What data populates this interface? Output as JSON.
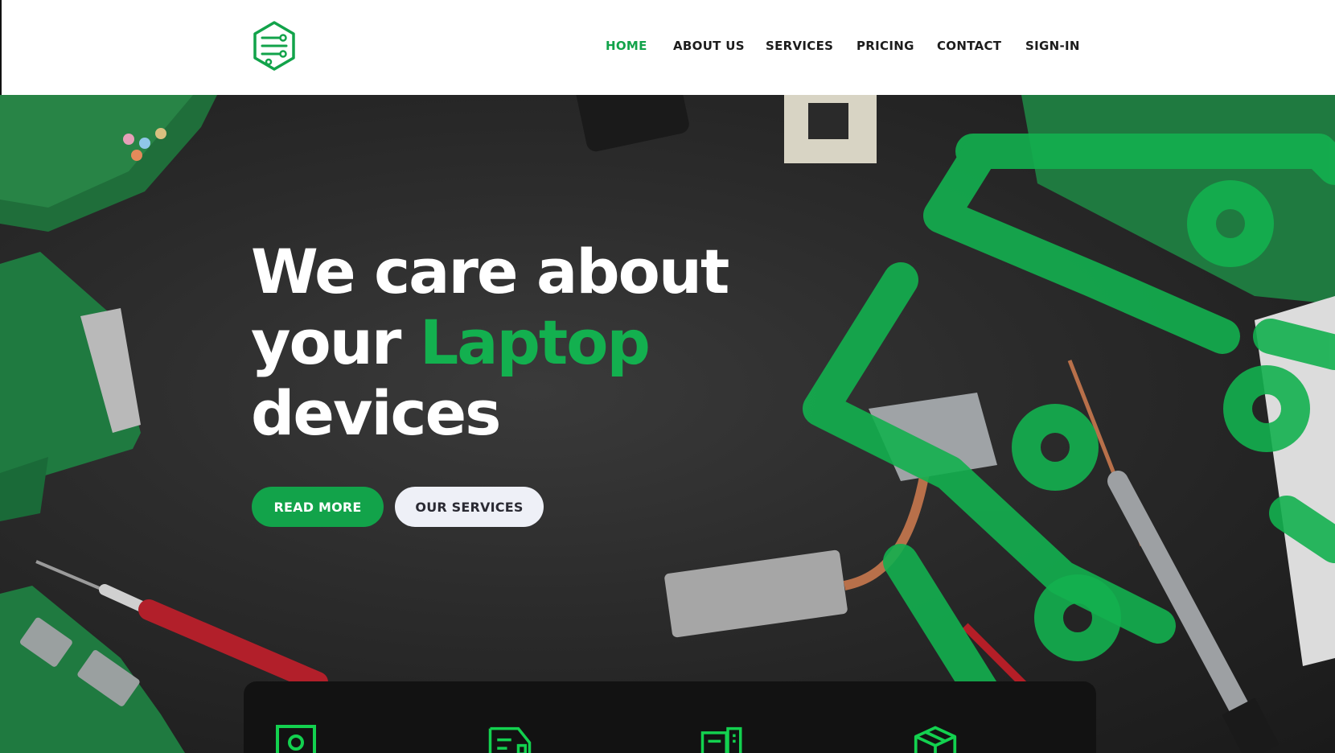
{
  "brand": {
    "logo_icon": "circuit-hexagon-logo",
    "accent_color": "#12a34a"
  },
  "nav": {
    "items": [
      {
        "label": "HOME",
        "active": true
      },
      {
        "label": "ABOUT US",
        "active": false
      },
      {
        "label": "SERVICES",
        "active": false
      },
      {
        "label": "PRICING",
        "active": false
      },
      {
        "label": "CONTACT",
        "active": false
      },
      {
        "label": "SIGN-IN",
        "active": false
      }
    ]
  },
  "hero": {
    "headline_line1": "We care about",
    "headline_line2_pre": "your ",
    "headline_accent": "Laptop",
    "headline_line3": "devices",
    "primary_button": "READ MORE",
    "secondary_button": "OUR SERVICES"
  },
  "services": {
    "icons": [
      "id-card-icon",
      "delivery-truck-icon",
      "computer-desktop-icon",
      "package-box-icon"
    ]
  }
}
